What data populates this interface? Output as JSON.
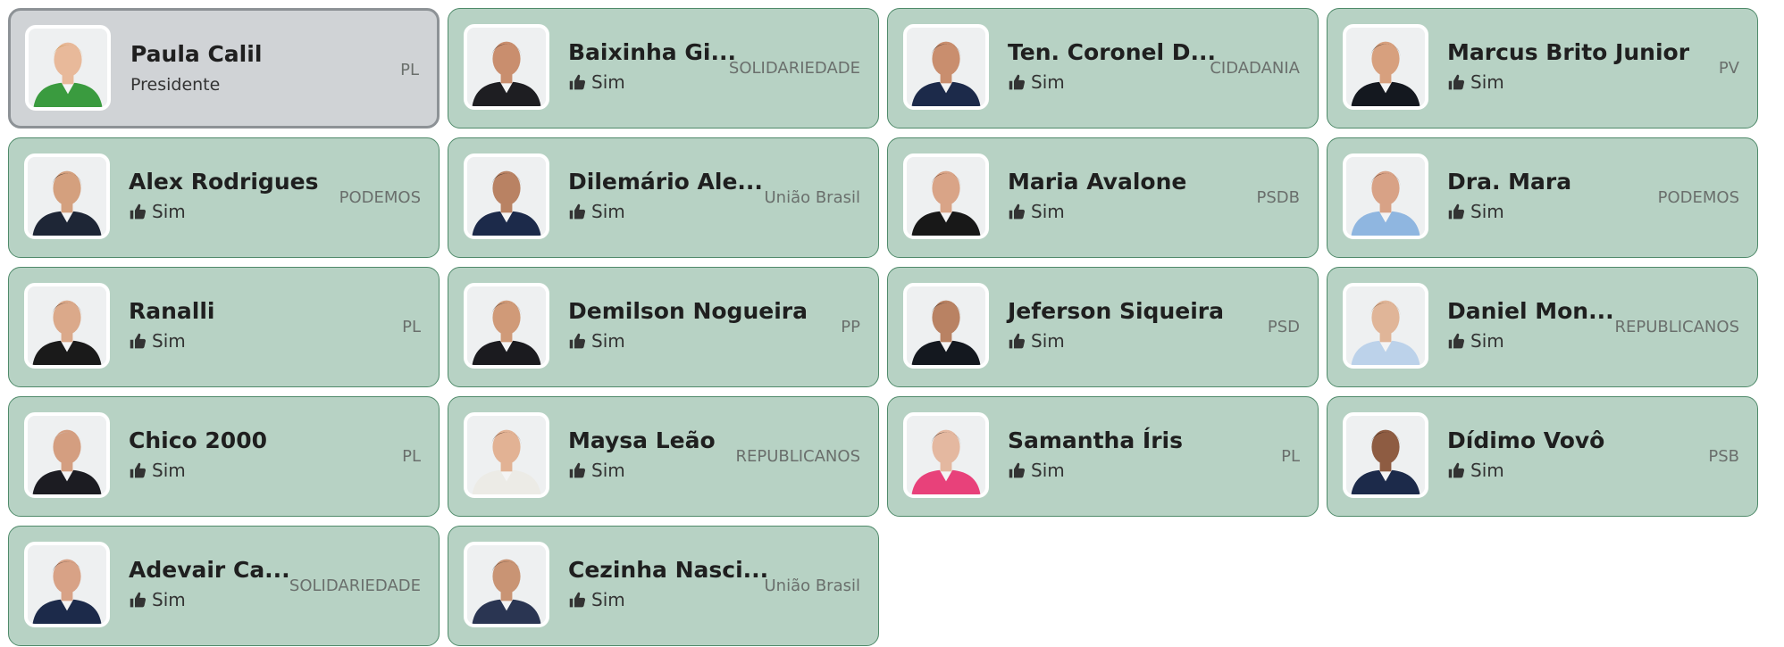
{
  "members": [
    {
      "name": "Paula Calil",
      "role": "Presidente",
      "party": "PL",
      "president": true,
      "skin": "#e8b99a",
      "hair": "#b8862a",
      "suit": "#3a9b3f"
    },
    {
      "name": "Baixinha Gi...",
      "vote": "Sim",
      "party": "SOLIDARIEDADE",
      "skin": "#c98e6e",
      "hair": "#2a1a14",
      "suit": "#1e1e22"
    },
    {
      "name": "Ten. Coronel D...",
      "vote": "Sim",
      "party": "CIDADANIA",
      "skin": "#c98e6e",
      "hair": "#1a1410",
      "suit": "#1c2a4a"
    },
    {
      "name": "Marcus Brito Junior",
      "vote": "Sim",
      "party": "PV",
      "skin": "#d7a07e",
      "hair": "#1a1410",
      "suit": "#14181f"
    },
    {
      "name": "Alex Rodrigues",
      "vote": "Sim",
      "party": "PODEMOS",
      "skin": "#d4a07e",
      "hair": "#1c1612",
      "suit": "#1e2636"
    },
    {
      "name": "Dilemário Ale...",
      "vote": "Sim",
      "party": "União Brasil",
      "skin": "#b98263",
      "hair": "#1a1410",
      "suit": "#1c2a4a"
    },
    {
      "name": "Maria Avalone",
      "vote": "Sim",
      "party": "PSDB",
      "skin": "#d9a487",
      "hair": "#4a2a1a",
      "suit": "#181818"
    },
    {
      "name": "Dra. Mara",
      "vote": "Sim",
      "party": "PODEMOS",
      "skin": "#d8a286",
      "hair": "#3a2216",
      "suit": "#8fb6e0"
    },
    {
      "name": "Ranalli",
      "vote": "Sim",
      "party": "PL",
      "skin": "#dba98a",
      "hair": "#3a2a1e",
      "suit": "#1a1a1a"
    },
    {
      "name": "Demilson Nogueira",
      "vote": "Sim",
      "party": "PP",
      "skin": "#d09a78",
      "hair": "#2a2420",
      "suit": "#1b1b1f"
    },
    {
      "name": "Jeferson Siqueira",
      "vote": "Sim",
      "party": "PSD",
      "skin": "#b98263",
      "hair": "#141414",
      "suit": "#14181f"
    },
    {
      "name": "Daniel Mon...",
      "vote": "Sim",
      "party": "REPUBLICANOS",
      "skin": "#e0b598",
      "hair": "#6a4a2a",
      "suit": "#bcd2ea"
    },
    {
      "name": "Chico 2000",
      "vote": "Sim",
      "party": "PL",
      "skin": "#d49e80",
      "hair": "#c9c4be",
      "suit": "#1c1c22"
    },
    {
      "name": "Maysa Leão",
      "vote": "Sim",
      "party": "REPUBLICANOS",
      "skin": "#e2b294",
      "hair": "#3a2216",
      "suit": "#ecebe6"
    },
    {
      "name": "Samantha Íris",
      "vote": "Sim",
      "party": "PL",
      "skin": "#e4b8a0",
      "hair": "#141414",
      "suit": "#e8417a"
    },
    {
      "name": "Dídimo Vovô",
      "vote": "Sim",
      "party": "PSB",
      "skin": "#8e5c42",
      "hair": "#1a1410",
      "suit": "#1c2a4a"
    },
    {
      "name": "Adevair Ca...",
      "vote": "Sim",
      "party": "SOLIDARIEDADE",
      "skin": "#d8a286",
      "hair": "#2a2420",
      "suit": "#1c2a4a"
    },
    {
      "name": "Cezinha Nasci...",
      "vote": "Sim",
      "party": "União Brasil",
      "skin": "#c99474",
      "hair": "#2a2420",
      "suit": "#2a3552"
    }
  ],
  "icons": {
    "thumb": "thumbs-up-icon"
  },
  "colors": {
    "card_bg": "#b7d2c4",
    "card_border": "#4f8a6a",
    "president_bg": "#d0d3d6",
    "president_border": "#8d9296"
  }
}
